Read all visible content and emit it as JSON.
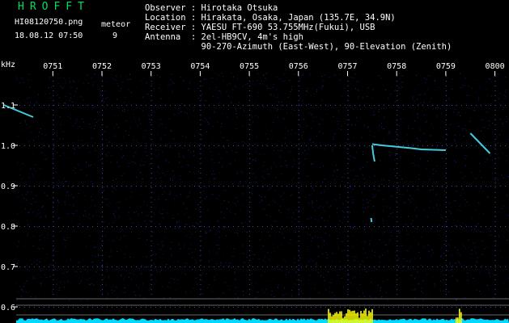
{
  "header": {
    "app_title": "HROFFT",
    "file_name": "HI08120750.png",
    "date_time": "18.08.12 07:50",
    "count_label": "meteor",
    "count_value": "9",
    "observer": "Observer : Hirotaka Otsuka",
    "location": "Location : Hirakata, Osaka, Japan (135.7E, 34.9N)",
    "receiver": "Receiver : YAESU FT-690 53.755MHz(Fukui), USB",
    "antenna": "Antenna  : 2el-HB9CV, 4m's high",
    "antenna2": "           90-270-Azimuth (East-West), 90-Elevation (Zenith)"
  },
  "colors": {
    "background": "#000000",
    "title": "#00e060",
    "noise": "#1a2a9a",
    "echo": "#4ff0ff",
    "spectrum": "#00d8ff",
    "spectrum_peak": "#ffff00",
    "ref_line": "#b0b0b0"
  },
  "chart_data": {
    "type": "heatmap",
    "ylabel": "kHz",
    "x_ticks": [
      "0751",
      "0752",
      "0753",
      "0754",
      "0755",
      "0756",
      "0757",
      "0758",
      "0759",
      "0800"
    ],
    "y_ticks": [
      "1.1",
      "1.0",
      "0.9",
      "0.8",
      "0.7",
      "0.6"
    ],
    "xlim": [
      "0750",
      "0800"
    ],
    "ylim": [
      0.58,
      1.14
    ],
    "traces": [
      {
        "x": [
          7.5,
          7.7,
          8.3,
          8.5,
          9.0
        ],
        "y": [
          1.003,
          1.0,
          0.993,
          0.99,
          0.988
        ]
      },
      {
        "x": [
          7.5,
          7.52,
          7.55
        ],
        "y": [
          1.0,
          0.98,
          0.96
        ]
      },
      {
        "x": [
          7.48,
          7.49
        ],
        "y": [
          0.82,
          0.81
        ]
      },
      {
        "x": [
          9.5,
          9.9
        ],
        "y": [
          1.03,
          0.98
        ]
      },
      {
        "x": [
          0.0,
          0.6
        ],
        "y": [
          1.1,
          1.07
        ]
      }
    ],
    "spectrum_peaks": [
      {
        "from": 6.6,
        "to": 7.5
      },
      {
        "from": 9.2,
        "to": 9.3
      }
    ]
  }
}
